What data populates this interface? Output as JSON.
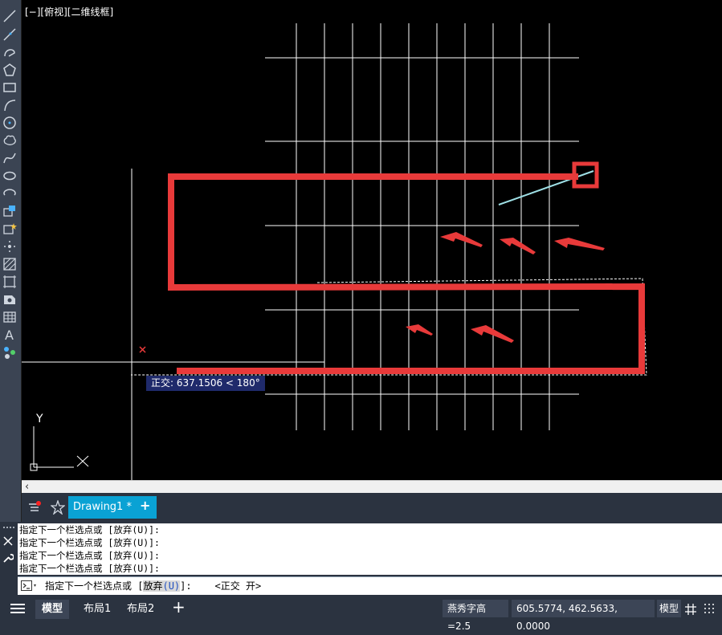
{
  "viewport": {
    "label": "[−][俯视][二维线框]"
  },
  "tooltip": {
    "text": "正交: 637.1506 < 180°"
  },
  "ucs": {
    "y_label": "Y",
    "x_label": "X"
  },
  "tabs": {
    "document": "Drawing1 *",
    "add": "+"
  },
  "command": {
    "history": [
      "指定下一个栏选点或 [放弃(U)]:",
      "指定下一个栏选点或 [放弃(U)]:",
      "指定下一个栏选点或 [放弃(U)]:",
      "指定下一个栏选点或 [放弃(U)]:"
    ],
    "prompt_prefix": "指定下一个栏选点或 [",
    "prompt_option": "放弃",
    "prompt_key": "(U)",
    "prompt_suffix": "]:    <正交 开>"
  },
  "status": {
    "model_tab": "模型",
    "layout1": "布局1",
    "layout2": "布局2",
    "add": "+",
    "text_height": "燕秀字高=2.5",
    "coords": "605.5774, 462.5633, 0.0000",
    "space": "模型"
  },
  "colors": {
    "annotation": "#e83a3a",
    "canvas": "#000000",
    "accent_tab": "#0aa2d4",
    "fence_line": "#9fe0e6"
  },
  "icons": [
    "line-icon",
    "polyline-icon",
    "arc-icon",
    "polygon-icon",
    "rectangle-icon",
    "arc2-icon",
    "circle-icon",
    "cloud-icon",
    "spline-icon",
    "ellipse-icon",
    "ellipse-arc-icon",
    "insert-block-icon",
    "make-block-icon",
    "point-icon",
    "hatch-icon",
    "region-icon",
    "table-icon",
    "text-icon",
    "add-selected-icon"
  ]
}
